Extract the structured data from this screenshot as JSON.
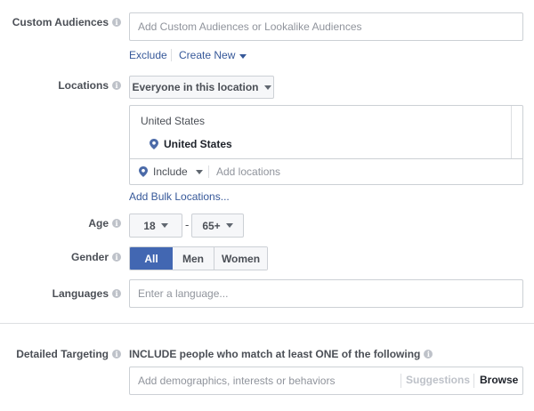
{
  "custom_audiences": {
    "label": "Custom Audiences",
    "placeholder": "Add Custom Audiences or Lookalike Audiences",
    "exclude": "Exclude",
    "create_new": "Create New"
  },
  "locations": {
    "label": "Locations",
    "dropdown": "Everyone in this location",
    "group_title": "United States",
    "selected": "United States",
    "include": "Include",
    "placeholder": "Add locations",
    "bulk": "Add Bulk Locations..."
  },
  "age": {
    "label": "Age",
    "min": "18",
    "separator": "-",
    "max": "65+"
  },
  "gender": {
    "label": "Gender",
    "options": [
      "All",
      "Men",
      "Women"
    ],
    "selected": "All"
  },
  "languages": {
    "label": "Languages",
    "placeholder": "Enter a language..."
  },
  "detailed_targeting": {
    "label": "Detailed Targeting",
    "description": "INCLUDE people who match at least ONE of the following",
    "placeholder": "Add demographics, interests or behaviors",
    "suggestions": "Suggestions",
    "browse": "Browse"
  },
  "info_glyph": "i",
  "colors": {
    "accent": "#4267b2",
    "link": "#365899",
    "pin": "#4b6aa8",
    "border": "#ccd0d5"
  }
}
